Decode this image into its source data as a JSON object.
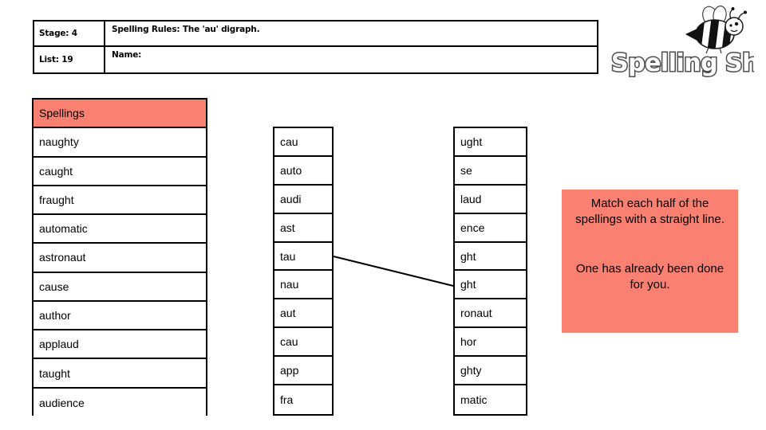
{
  "header": {
    "stage_label": "Stage: 4",
    "list_label": "List: 19",
    "rules_label": "Spelling Rules: The 'au' digraph.",
    "name_label": "Name:"
  },
  "logo": {
    "wordmark": "Spelling Shed",
    "bee_icon": "bee-icon"
  },
  "worksheet": {
    "spellings_header": "Spellings",
    "spellings": [
      "naughty",
      "caught",
      "fraught",
      "automatic",
      "astronaut",
      "cause",
      "author",
      "applaud",
      "taught",
      "audience"
    ],
    "first_halves": [
      "cau",
      "auto",
      "audi",
      "ast",
      "tau",
      "nau",
      "aut",
      "cau",
      "app",
      "fra"
    ],
    "second_halves": [
      "ught",
      "se",
      "laud",
      "ence",
      "ght",
      "ght",
      "ronaut",
      "hor",
      "ghty",
      "matic"
    ],
    "completed_match": {
      "from_index": 4,
      "to_index": 5,
      "from_text": "tau",
      "to_text": "ght"
    }
  },
  "instructions": {
    "line_1": "Match each half of the spellings with a straight line.",
    "line_2": "One has already been done for you."
  },
  "colors": {
    "accent_pink": "#fa8072",
    "border": "#000000",
    "background": "#ffffff"
  }
}
